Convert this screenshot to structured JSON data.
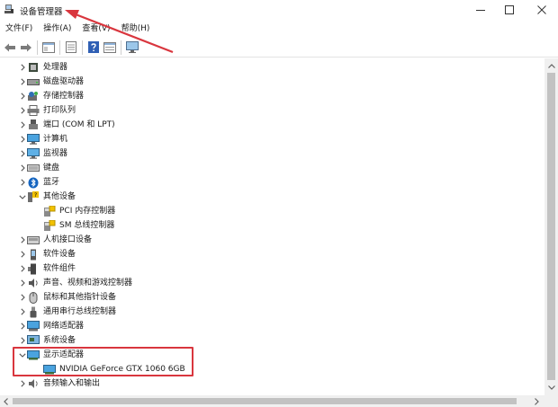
{
  "window": {
    "title": "设备管理器"
  },
  "menu": [
    {
      "label": "文件(F)"
    },
    {
      "label": "操作(A)"
    },
    {
      "label": "查看(V)"
    },
    {
      "label": "帮助(H)"
    }
  ],
  "tree": [
    {
      "label": "处理器",
      "indent": 0,
      "expand": "collapsed",
      "icon": "processor-icon"
    },
    {
      "label": "磁盘驱动器",
      "indent": 0,
      "expand": "collapsed",
      "icon": "disk-icon"
    },
    {
      "label": "存储控制器",
      "indent": 0,
      "expand": "collapsed",
      "icon": "storage-controller-icon"
    },
    {
      "label": "打印队列",
      "indent": 0,
      "expand": "collapsed",
      "icon": "printer-icon"
    },
    {
      "label": "端口 (COM 和 LPT)",
      "indent": 0,
      "expand": "collapsed",
      "icon": "port-icon"
    },
    {
      "label": "计算机",
      "indent": 0,
      "expand": "collapsed",
      "icon": "computer-icon"
    },
    {
      "label": "监视器",
      "indent": 0,
      "expand": "collapsed",
      "icon": "monitor-icon"
    },
    {
      "label": "键盘",
      "indent": 0,
      "expand": "collapsed",
      "icon": "keyboard-icon"
    },
    {
      "label": "蓝牙",
      "indent": 0,
      "expand": "collapsed",
      "icon": "bluetooth-icon"
    },
    {
      "label": "其他设备",
      "indent": 0,
      "expand": "expanded",
      "icon": "other-devices-icon"
    },
    {
      "label": "PCI 内存控制器",
      "indent": 1,
      "expand": "none",
      "icon": "unknown-device-icon"
    },
    {
      "label": "SM 总线控制器",
      "indent": 1,
      "expand": "none",
      "icon": "unknown-device-icon"
    },
    {
      "label": "人机接口设备",
      "indent": 0,
      "expand": "collapsed",
      "icon": "hid-icon"
    },
    {
      "label": "软件设备",
      "indent": 0,
      "expand": "collapsed",
      "icon": "software-device-icon"
    },
    {
      "label": "软件组件",
      "indent": 0,
      "expand": "collapsed",
      "icon": "software-component-icon"
    },
    {
      "label": "声音、视频和游戏控制器",
      "indent": 0,
      "expand": "collapsed",
      "icon": "speaker-icon"
    },
    {
      "label": "鼠标和其他指针设备",
      "indent": 0,
      "expand": "collapsed",
      "icon": "mouse-icon"
    },
    {
      "label": "通用串行总线控制器",
      "indent": 0,
      "expand": "collapsed",
      "icon": "usb-icon"
    },
    {
      "label": "网络适配器",
      "indent": 0,
      "expand": "collapsed",
      "icon": "network-adapter-icon"
    },
    {
      "label": "系统设备",
      "indent": 0,
      "expand": "collapsed",
      "icon": "system-device-icon"
    },
    {
      "label": "显示适配器",
      "indent": 0,
      "expand": "expanded",
      "icon": "display-adapter-icon"
    },
    {
      "label": "NVIDIA GeForce GTX 1060 6GB",
      "indent": 1,
      "expand": "none",
      "icon": "gpu-icon"
    },
    {
      "label": "音频输入和输出",
      "indent": 0,
      "expand": "collapsed",
      "icon": "audio-io-icon"
    }
  ],
  "colors": {
    "highlight_box": "#d9363e",
    "annotation_arrow": "#d9363e"
  }
}
